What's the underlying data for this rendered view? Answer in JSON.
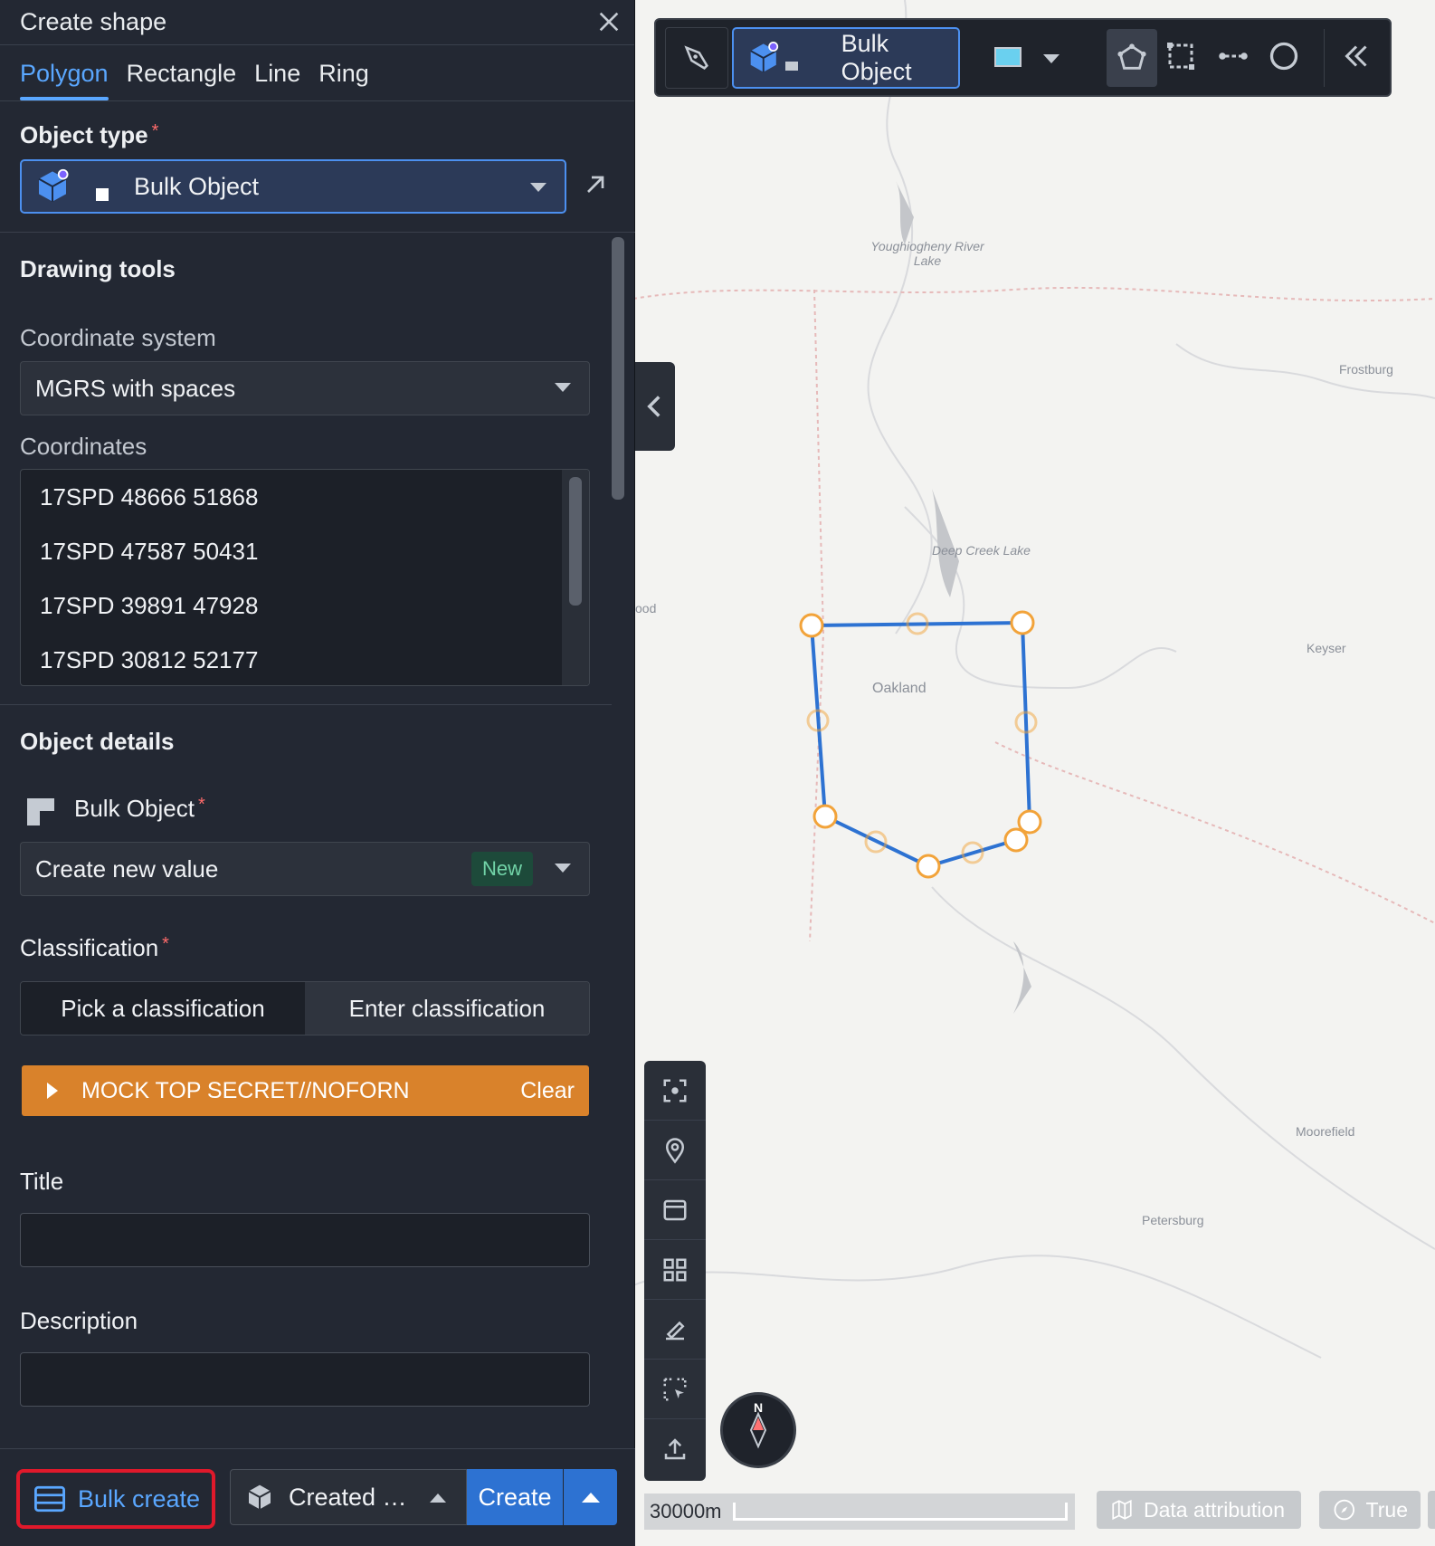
{
  "panel": {
    "title": "Create shape",
    "tabs": [
      "Polygon",
      "Rectangle",
      "Line",
      "Ring"
    ],
    "object_type_label": "Object type",
    "object_type_value": "Bulk Object",
    "drawing_tools_heading": "Drawing tools",
    "coordinate_system_label": "Coordinate system",
    "coordinate_system_value": "MGRS with spaces",
    "coordinates_label": "Coordinates",
    "coordinates": [
      "17SPD 48666 51868",
      "17SPD 47587 50431",
      "17SPD 39891 47928",
      "17SPD 30812 52177"
    ],
    "object_details_heading": "Object details",
    "bulk_object_label": "Bulk Object",
    "bulk_object_value": "Create new value",
    "new_tag": "New",
    "classification_label": "Classification",
    "classification_options": [
      "Pick a classification",
      "Enter classification"
    ],
    "classification_value": "MOCK TOP SECRET//NOFORN",
    "classification_clear": "Clear",
    "classification_color": "#d9822b",
    "title_label": "Title",
    "title_value": "",
    "description_label": "Description",
    "description_value": ""
  },
  "footer": {
    "bulk_create": "Bulk create",
    "created_select": "Created …",
    "create": "Create"
  },
  "map_toolbar": {
    "object_label": "Bulk Object",
    "fill_color": "#6ad0ef"
  },
  "map": {
    "labels": [
      "Youghiogheny River Lake",
      "Frostburg",
      "Deep Creek Lake",
      "ood",
      "Keyser",
      "Oakland",
      "Moorefield",
      "Petersburg"
    ],
    "scale": "30000m",
    "compass_n": "N",
    "data_attribution": "Data attribution",
    "true_north": "True",
    "polygon_color": "#2d72d2",
    "vertex_color": "#f2a33a"
  }
}
